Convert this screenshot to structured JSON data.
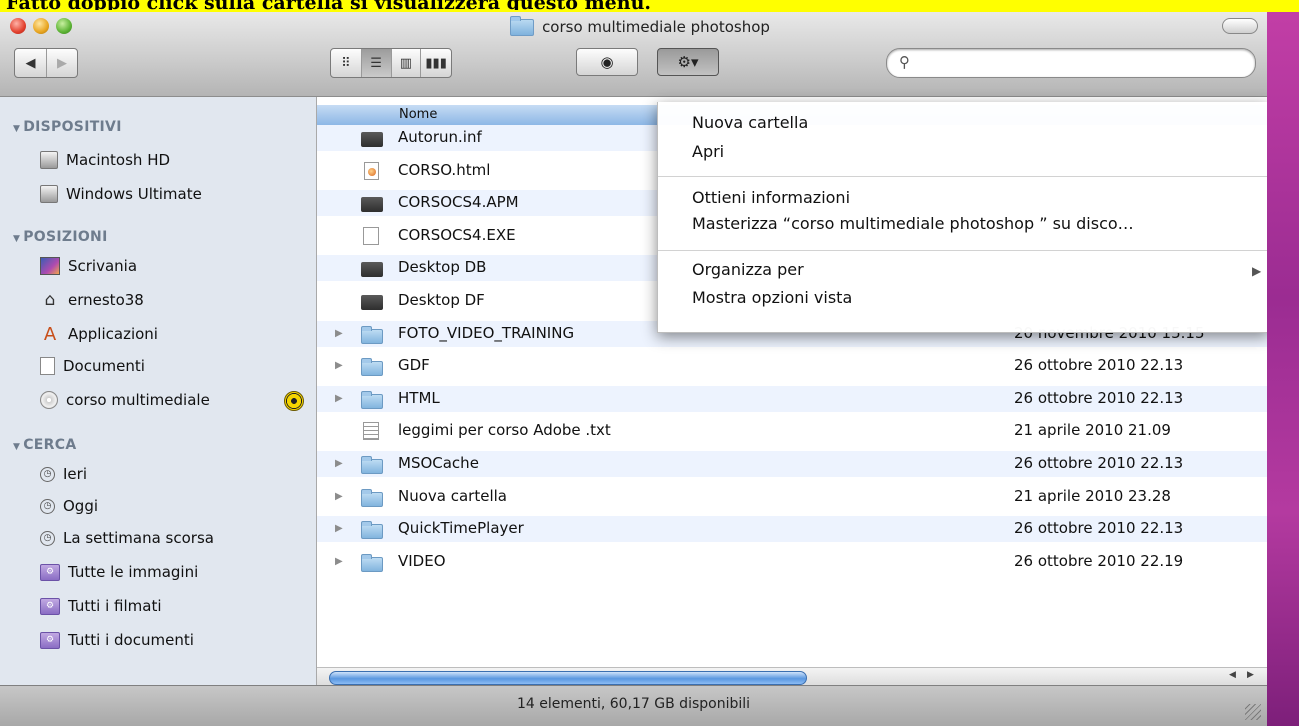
{
  "caption": "Fatto doppio click sulla cartella si visualizzerà questo menu.",
  "window": {
    "title": "corso multimediale photoshop"
  },
  "toolbar": {
    "back": "◀",
    "forward": "▶",
    "views": [
      "icons",
      "list",
      "columns",
      "coverflow"
    ],
    "selected_view": "list",
    "quicklook_glyph": "◉",
    "action_glyph": "⚙▾",
    "search_value": ""
  },
  "sidebar": {
    "sections": [
      {
        "title": "DISPOSITIVI",
        "items": [
          {
            "label": "Macintosh HD",
            "icon": "hard-disk-icon"
          },
          {
            "label": "Windows Ultimate",
            "icon": "hard-disk-icon"
          }
        ]
      },
      {
        "title": "POSIZIONI",
        "items": [
          {
            "label": "Scrivania",
            "icon": "desktop-icon"
          },
          {
            "label": "ernesto38",
            "icon": "home-icon"
          },
          {
            "label": "Applicazioni",
            "icon": "applications-icon"
          },
          {
            "label": "Documenti",
            "icon": "document-icon"
          },
          {
            "label": "corso multimediale",
            "icon": "cd-icon"
          }
        ]
      },
      {
        "title": "CERCA",
        "items": [
          {
            "label": "Ieri",
            "icon": "clock-icon"
          },
          {
            "label": "Oggi",
            "icon": "clock-icon"
          },
          {
            "label": "La settimana scorsa",
            "icon": "clock-icon"
          },
          {
            "label": "Tutte le immagini",
            "icon": "smart-folder-icon"
          },
          {
            "label": "Tutti i filmati",
            "icon": "smart-folder-icon"
          },
          {
            "label": "Tutti i documenti",
            "icon": "smart-folder-icon"
          }
        ]
      }
    ]
  },
  "list": {
    "col_name": "Nome",
    "rows": [
      {
        "name": "Autorun.inf",
        "date": "",
        "kind": "bin"
      },
      {
        "name": "CORSO.html",
        "date": "",
        "kind": "html"
      },
      {
        "name": "CORSOCS4.APM",
        "date": "",
        "kind": "bin"
      },
      {
        "name": "CORSOCS4.EXE",
        "date": "",
        "kind": "exe"
      },
      {
        "name": "Desktop DB",
        "date": "",
        "kind": "bin"
      },
      {
        "name": "Desktop DF",
        "date": "",
        "kind": "bin"
      },
      {
        "name": "FOTO_VIDEO_TRAINING",
        "date": "20 novembre 2010 15.15",
        "kind": "folder"
      },
      {
        "name": "GDF",
        "date": "26 ottobre 2010 22.13",
        "kind": "folder"
      },
      {
        "name": "HTML",
        "date": "26 ottobre 2010 22.13",
        "kind": "folder"
      },
      {
        "name": "leggimi per corso Adobe .txt",
        "date": "21 aprile 2010 21.09",
        "kind": "txt"
      },
      {
        "name": "MSOCache",
        "date": "26 ottobre 2010 22.13",
        "kind": "folder"
      },
      {
        "name": "Nuova cartella",
        "date": "21 aprile 2010 23.28",
        "kind": "folder"
      },
      {
        "name": "QuickTimePlayer",
        "date": "26 ottobre 2010 22.13",
        "kind": "folder"
      },
      {
        "name": "VIDEO",
        "date": "26 ottobre 2010 22.19",
        "kind": "folder"
      }
    ]
  },
  "menu": {
    "groups": [
      [
        "Nuova cartella",
        "Apri"
      ],
      [
        "Ottieni informazioni",
        "Masterizza “corso multimediale photoshop ” su disco…"
      ],
      [
        "Organizza per",
        "Mostra opzioni vista"
      ]
    ]
  },
  "status": {
    "text": "14 elementi, 60,17 GB disponibili"
  }
}
